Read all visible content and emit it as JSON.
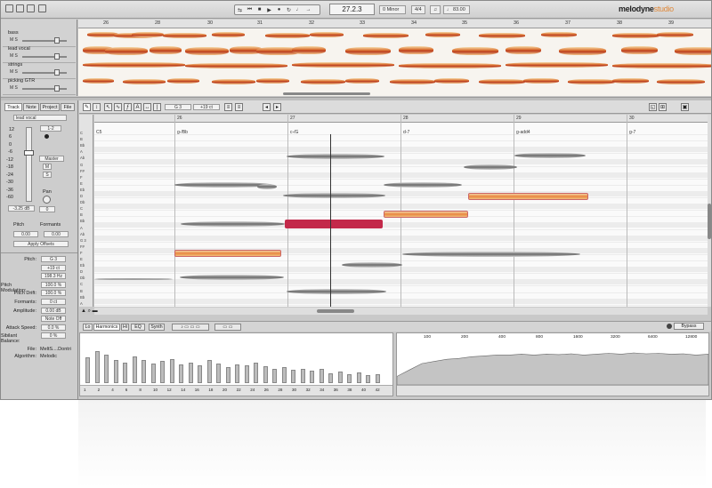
{
  "toolbar": {
    "position": "27.2.3",
    "key": "0 Minor",
    "meter": "4/4",
    "tempo": "83.00",
    "logo_main": "melodyne",
    "logo_sub": "studio"
  },
  "arrange": {
    "bars": [
      "26",
      "28",
      "30",
      "31",
      "32",
      "33",
      "34",
      "35",
      "36",
      "37",
      "38",
      "39"
    ],
    "tracks": [
      {
        "name": "bass"
      },
      {
        "name": "lead vocal"
      },
      {
        "name": "strings"
      },
      {
        "name": "picking GTR"
      }
    ]
  },
  "inspector": {
    "tabs": [
      "Track",
      "Note",
      "Project",
      "File"
    ],
    "active_tab": "Track",
    "track_name": "lead vocal",
    "db_scale": [
      "12",
      "6",
      "0",
      "-6",
      "-12",
      "-18",
      "-24",
      "-30",
      "-36",
      "-60"
    ],
    "channel": "1-2",
    "output": "Master",
    "fader_value": "-3.25 dB",
    "pan_label": "Pan",
    "pan_value": "0",
    "pitch_label": "Pitch",
    "pitch_value": "0.00",
    "formants_label": "Formants",
    "formants_value": "0.00",
    "apply_offsets": "Apply Offsets",
    "params": [
      {
        "label": "Pitch:",
        "value": "G 3"
      },
      {
        "label": "",
        "value": "+19 ct"
      },
      {
        "label": "",
        "value": "198.3 Hz"
      },
      {
        "label": "Pitch Modulation:",
        "value": "100.0 %"
      },
      {
        "label": "Pitch Drift:",
        "value": "100.0 %"
      },
      {
        "label": "Formants:",
        "value": "0 ct"
      },
      {
        "label": "Amplitude:",
        "value": "0.00 dB"
      },
      {
        "label": "",
        "value": "Note Off"
      },
      {
        "label": "Attack Speed:",
        "value": "0.0 %"
      },
      {
        "label": "Sibilant Balance:",
        "value": "0 %"
      }
    ],
    "file_label": "File:",
    "file_value": "MeltS....Dontri",
    "algorithm_label": "Algorithm:",
    "algorithm_value": "Melodic"
  },
  "editor": {
    "pitch_field": "G 3",
    "cents_field": "+19 ct",
    "bars": [
      "26",
      "27",
      "28",
      "29",
      "30"
    ],
    "chords": [
      "C5",
      "g-/Bb",
      "c-/G",
      "d-7",
      "g-add4",
      "g-7"
    ],
    "keys": [
      "C",
      "B",
      "Bb",
      "A",
      "Ab",
      "G",
      "F#",
      "F",
      "E",
      "Eb",
      "D",
      "Db",
      "C",
      "B",
      "Bb",
      "A",
      "Ab",
      "G 3",
      "F#",
      "F",
      "E",
      "Eb",
      "D",
      "Db",
      "C",
      "B",
      "Bb",
      "A"
    ]
  },
  "sound_editor": {
    "tabs": [
      "Lo",
      "Harmonics",
      "Hi",
      "EQ",
      "Synth"
    ],
    "active_tab": "Harmonics",
    "bypass": "Bypass",
    "freq_labels": [
      "100",
      "200",
      "400",
      "800",
      "1600",
      "3200",
      "6400",
      "12800"
    ],
    "harmonic_numbers": [
      "1",
      "2",
      "4",
      "6",
      "8",
      "10",
      "12",
      "14",
      "16",
      "18",
      "20",
      "22",
      "24",
      "26",
      "28",
      "30",
      "32",
      "34",
      "36",
      "38",
      "40",
      "42"
    ],
    "harmonic_levels": [
      0.55,
      0.7,
      0.62,
      0.5,
      0.45,
      0.58,
      0.5,
      0.42,
      0.48,
      0.52,
      0.4,
      0.45,
      0.38,
      0.5,
      0.42,
      0.35,
      0.4,
      0.38,
      0.44,
      0.36,
      0.3,
      0.34,
      0.28,
      0.3,
      0.26,
      0.3,
      0.22,
      0.25,
      0.2,
      0.24,
      0.18,
      0.2
    ],
    "eq_levels": [
      0.2,
      0.35,
      0.5,
      0.55,
      0.6,
      0.62,
      0.66,
      0.68,
      0.7,
      0.7,
      0.72,
      0.7,
      0.72,
      0.71,
      0.73,
      0.7,
      0.72,
      0.74,
      0.72,
      0.75,
      0.73,
      0.74,
      0.72,
      0.73,
      0.7,
      0.72
    ]
  }
}
